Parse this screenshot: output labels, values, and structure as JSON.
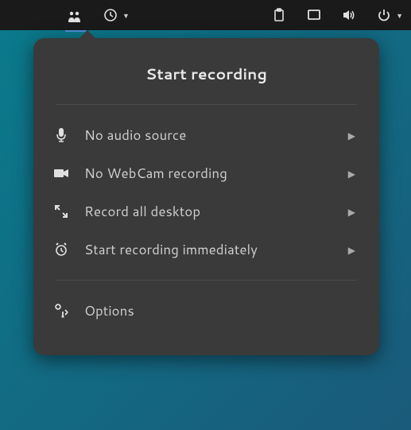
{
  "popover": {
    "title": "Start recording",
    "items": [
      {
        "icon": "microphone-icon",
        "label": "No audio source",
        "has_submenu": true
      },
      {
        "icon": "webcam-icon",
        "label": "No WebCam recording",
        "has_submenu": true
      },
      {
        "icon": "expand-icon",
        "label": "Record all desktop",
        "has_submenu": true
      },
      {
        "icon": "alarm-icon",
        "label": "Start recording immediately",
        "has_submenu": true
      }
    ],
    "options_label": "Options"
  },
  "topbar": {
    "recorder_icon": "recorder-icon",
    "clock_icon": "clock-icon",
    "clipboard_icon": "clipboard-icon",
    "screen_icon": "screen-icon",
    "volume_icon": "volume-icon",
    "power_icon": "power-icon"
  }
}
